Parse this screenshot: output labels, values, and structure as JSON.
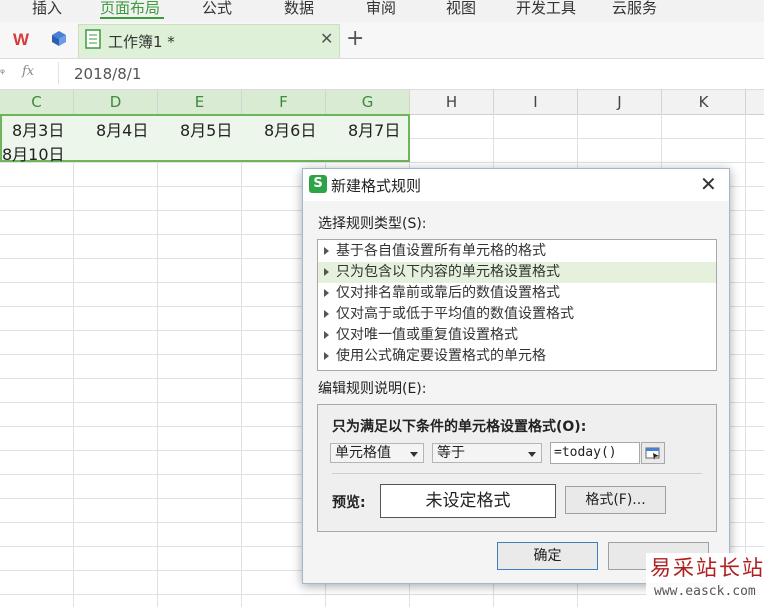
{
  "ribbon": {
    "menu": [
      "插入",
      "页面布局",
      "公式",
      "数据",
      "审阅",
      "视图",
      "开发工具",
      "云服务"
    ],
    "active_index": 1
  },
  "tabs": {
    "document_title": "工作簿1 *"
  },
  "formula_bar": {
    "fx_label": "fx",
    "value": "2018/8/1"
  },
  "sheet": {
    "columns": [
      "C",
      "D",
      "E",
      "F",
      "G",
      "H",
      "I",
      "J",
      "K"
    ],
    "row1": [
      "8月3日",
      "8月4日",
      "8月5日",
      "8月6日",
      "8月7日"
    ],
    "row2": [
      "8月10日"
    ]
  },
  "dialog": {
    "title": "新建格式规则",
    "rule_type_label": "选择规则类型(S):",
    "rule_types": [
      "基于各自值设置所有单元格的格式",
      "只为包含以下内容的单元格设置格式",
      "仅对排名靠前或靠后的数值设置格式",
      "仅对高于或低于平均值的数值设置格式",
      "仅对唯一值或重复值设置格式",
      "使用公式确定要设置格式的单元格"
    ],
    "selected_rule_index": 1,
    "edit_label": "编辑规则说明(E):",
    "condition_heading": "只为满足以下条件的单元格设置格式(O):",
    "condition_field": "单元格值",
    "condition_operator": "等于",
    "condition_value": "=today()",
    "preview_label": "预览:",
    "preview_text": "未设定格式",
    "format_button": "格式(F)...",
    "ok_button": "确定"
  },
  "watermark": {
    "cn": "易采站长站",
    "url": "www.easck.com"
  },
  "colors": {
    "accent_green": "#3e9a3e",
    "selection_border": "#6db45a",
    "selected_rule_bg": "#e5f1dc"
  }
}
